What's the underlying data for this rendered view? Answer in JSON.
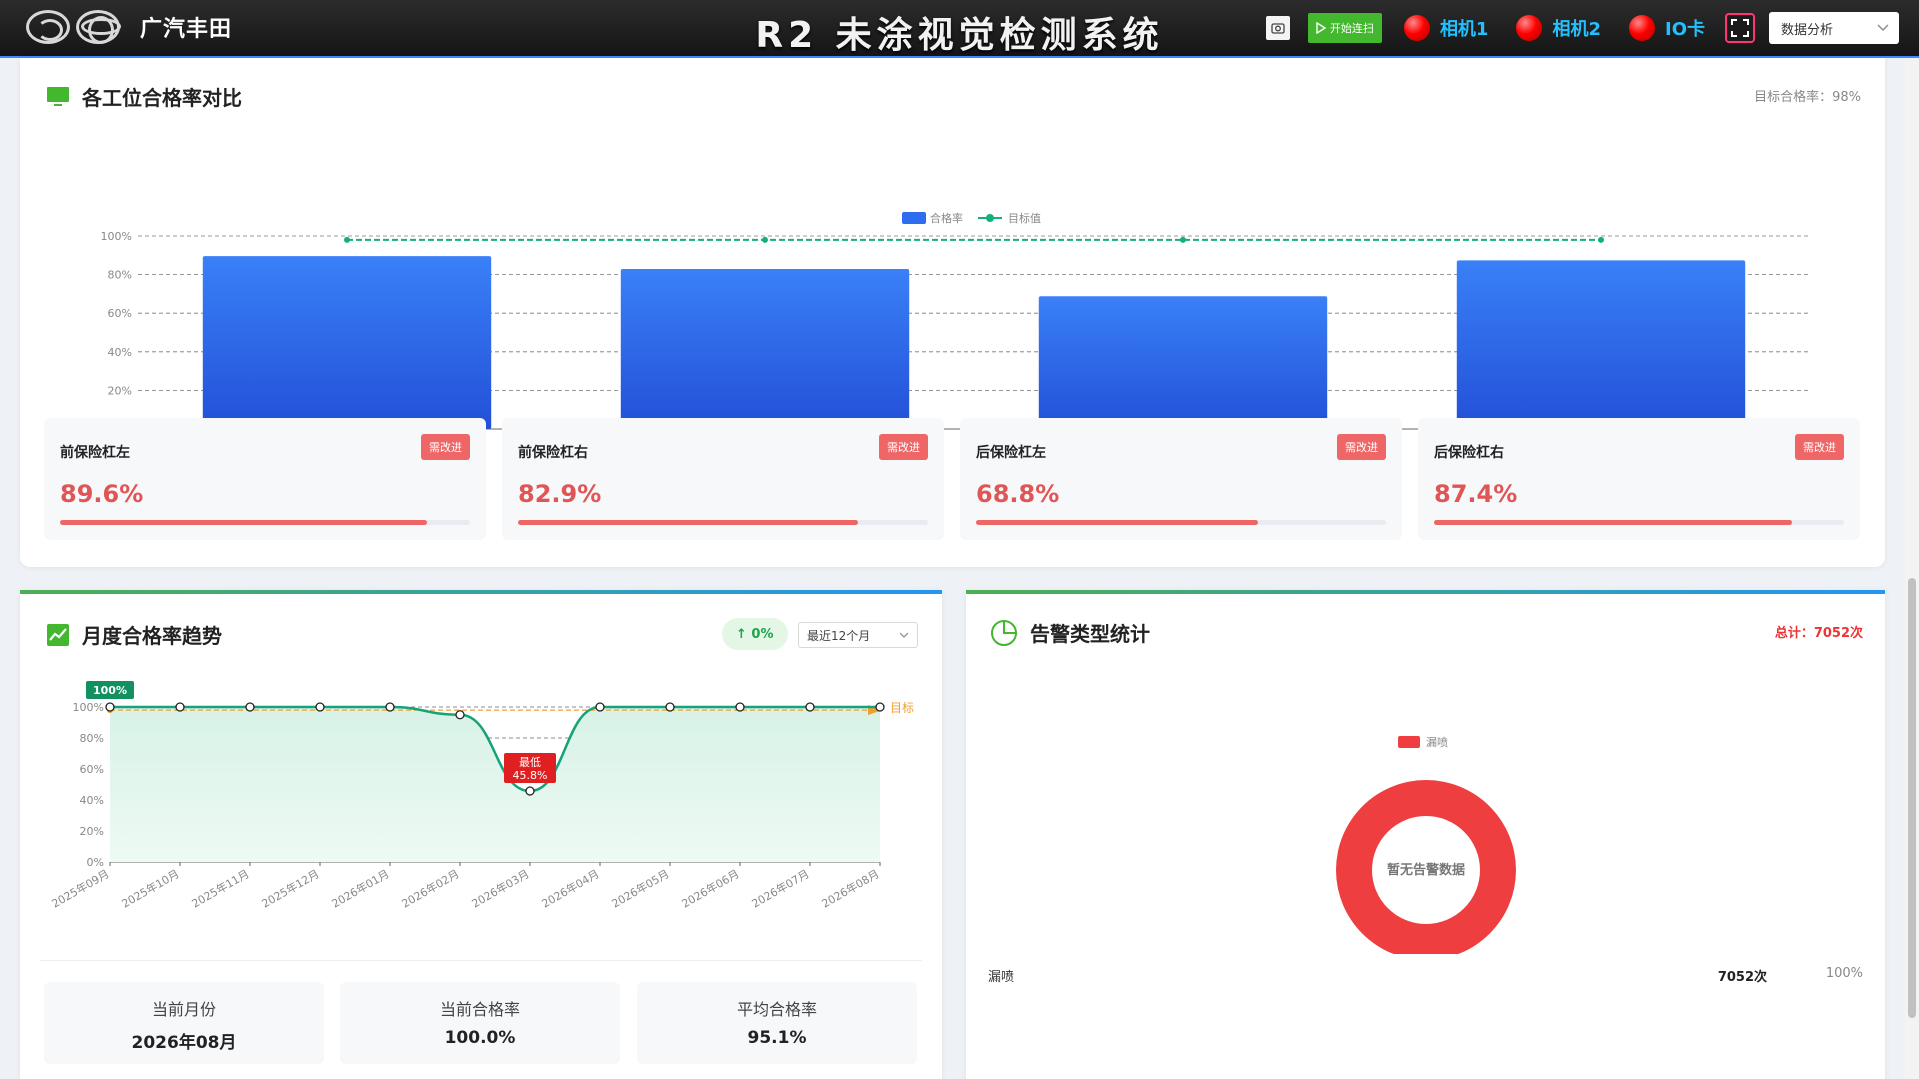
{
  "header": {
    "brand": "广汽丰田",
    "title": "R2 未涂视觉检测系统",
    "start_label": "开始连扫",
    "status": [
      {
        "label": "相机1",
        "color": "#ff0000"
      },
      {
        "label": "相机2",
        "color": "#ff0000"
      },
      {
        "label": "IO卡",
        "color": "#ff0000"
      }
    ],
    "view_select": "数据分析"
  },
  "pass_rate": {
    "title": "各工位合格率对比",
    "target_note": "目标合格率：98%",
    "legend_bar": "合格率",
    "legend_line": "目标值",
    "stations": [
      {
        "name": "前保险杠左",
        "value": "89.6%",
        "badge": "需改进"
      },
      {
        "name": "前保险杠右",
        "value": "82.9%",
        "badge": "需改进"
      },
      {
        "name": "后保险杠左",
        "value": "68.8%",
        "badge": "需改进"
      },
      {
        "name": "后保险杠右",
        "value": "87.4%",
        "badge": "需改进"
      }
    ]
  },
  "trend": {
    "title": "月度合格率趋势",
    "change": "↑ 0%",
    "period": "最近12个月",
    "max_label": "100%",
    "min_label": "最低",
    "min_value": "45.8%",
    "target_label": "目标",
    "stats": [
      {
        "label": "当前月份",
        "value": "2026年08月"
      },
      {
        "label": "当前合格率",
        "value": "100.0%"
      },
      {
        "label": "平均合格率",
        "value": "95.1%"
      }
    ]
  },
  "alarm": {
    "title": "告警类型统计",
    "total": "总计：7052次",
    "legend": "漏喷",
    "center_text": "暂无告警数据",
    "slice_label": "漏喷",
    "slice_detail": "7052次 (100%)",
    "row_name": "漏喷",
    "row_count": "7052次",
    "row_pct": "100%"
  },
  "chart_data": [
    {
      "type": "bar",
      "categories": [
        "前保险杠左",
        "前保险杠右",
        "后保险杠左",
        "后保险杠右"
      ],
      "series": [
        {
          "name": "合格率",
          "values": [
            89.6,
            82.9,
            68.8,
            87.4
          ]
        },
        {
          "name": "目标值",
          "values": [
            98,
            98,
            98,
            98
          ]
        }
      ],
      "ylim": [
        0,
        100
      ],
      "yticks": [
        "0%",
        "20%",
        "40%",
        "60%",
        "80%",
        "100%"
      ],
      "colors": {
        "bar": "#2f6df0",
        "target": "#12b07a"
      }
    },
    {
      "type": "area",
      "categories": [
        "2025年09月",
        "2025年10月",
        "2025年11月",
        "2025年12月",
        "2026年01月",
        "2026年02月",
        "2026年03月",
        "2026年04月",
        "2026年05月",
        "2026年06月",
        "2026年07月",
        "2026年08月"
      ],
      "values": [
        100,
        100,
        100,
        100,
        100,
        95,
        45.8,
        100,
        100,
        100,
        100,
        100
      ],
      "target": 98,
      "ylim": [
        0,
        100
      ],
      "yticks": [
        "0%",
        "20%",
        "40%",
        "60%",
        "80%",
        "100%"
      ],
      "colors": {
        "line": "#16a37a",
        "fill": "#d7f2e7",
        "min": "#e02020",
        "max": "#12905f",
        "target": "#f0a030"
      }
    },
    {
      "type": "pie",
      "slices": [
        {
          "label": "漏喷",
          "value": 7052,
          "percent": 100
        }
      ],
      "colors": {
        "slice": "#ee3e40"
      }
    }
  ]
}
